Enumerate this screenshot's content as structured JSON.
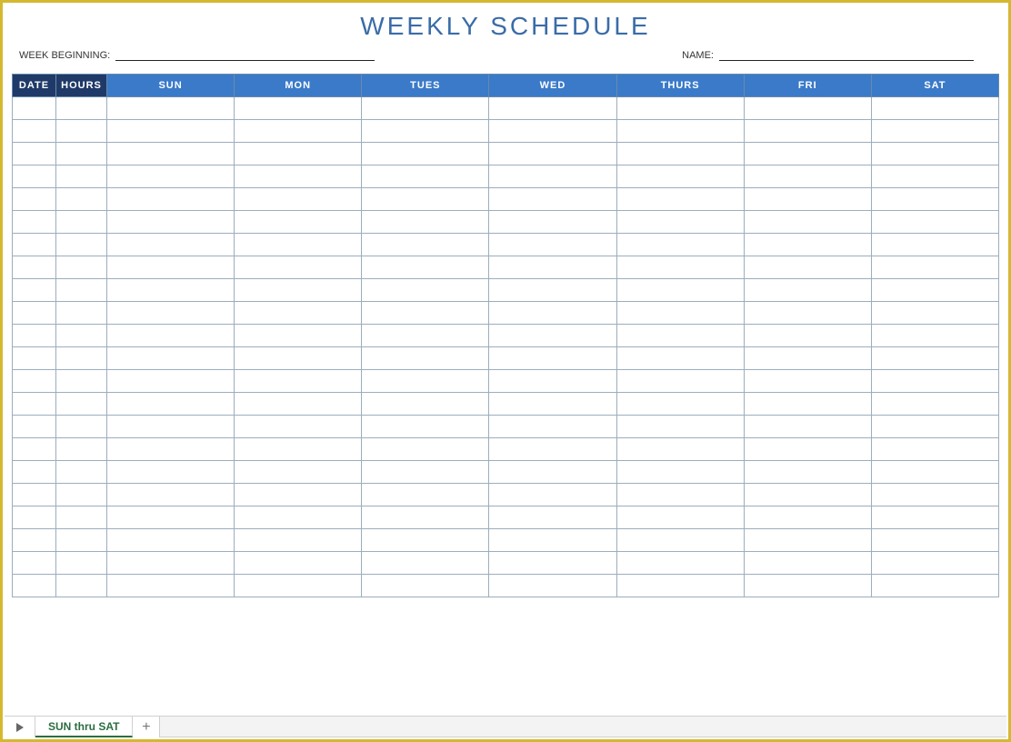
{
  "title": "WEEKLY SCHEDULE",
  "meta": {
    "week_label": "WEEK BEGINNING:",
    "week_value": "",
    "name_label": "NAME:",
    "name_value": ""
  },
  "table": {
    "headers": {
      "date": "DATE",
      "hours": "HOURS",
      "days": [
        "SUN",
        "MON",
        "TUES",
        "WED",
        "THURS",
        "FRI",
        "SAT"
      ]
    },
    "row_count": 22
  },
  "tabs": {
    "active": "SUN thru SAT"
  }
}
